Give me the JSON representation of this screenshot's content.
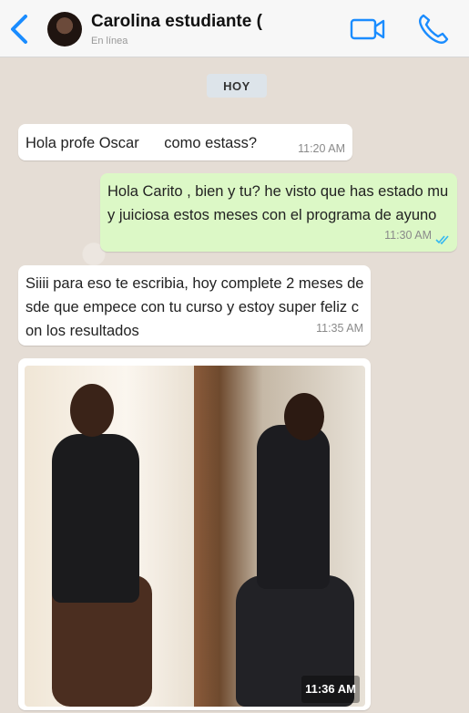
{
  "header": {
    "title": "Carolina estudiante (",
    "status": "En línea",
    "accent": "#1a8cff"
  },
  "chat": {
    "day_label": "HOY",
    "messages": [
      {
        "direction": "in",
        "text": "Hola profe Oscar      como estass?",
        "time": "11:20 AM"
      },
      {
        "direction": "out",
        "text": "Hola Carito , bien y tu? he visto que has estado muy juiciosa estos meses con el programa de ayuno",
        "time": "11:30 AM",
        "status": "read"
      },
      {
        "direction": "in",
        "text": "Siiii para eso te escribia, hoy complete 2 meses desde que empece con tu curso y estoy super feliz con los resultados",
        "time": "11:35 AM"
      },
      {
        "direction": "in",
        "type": "image",
        "time": "11:36 AM"
      }
    ]
  },
  "colors": {
    "incoming_bubble": "#ffffff",
    "outgoing_bubble": "#dcf8c6",
    "chat_background": "#e5ddd5",
    "read_ticks": "#34b7f1"
  }
}
